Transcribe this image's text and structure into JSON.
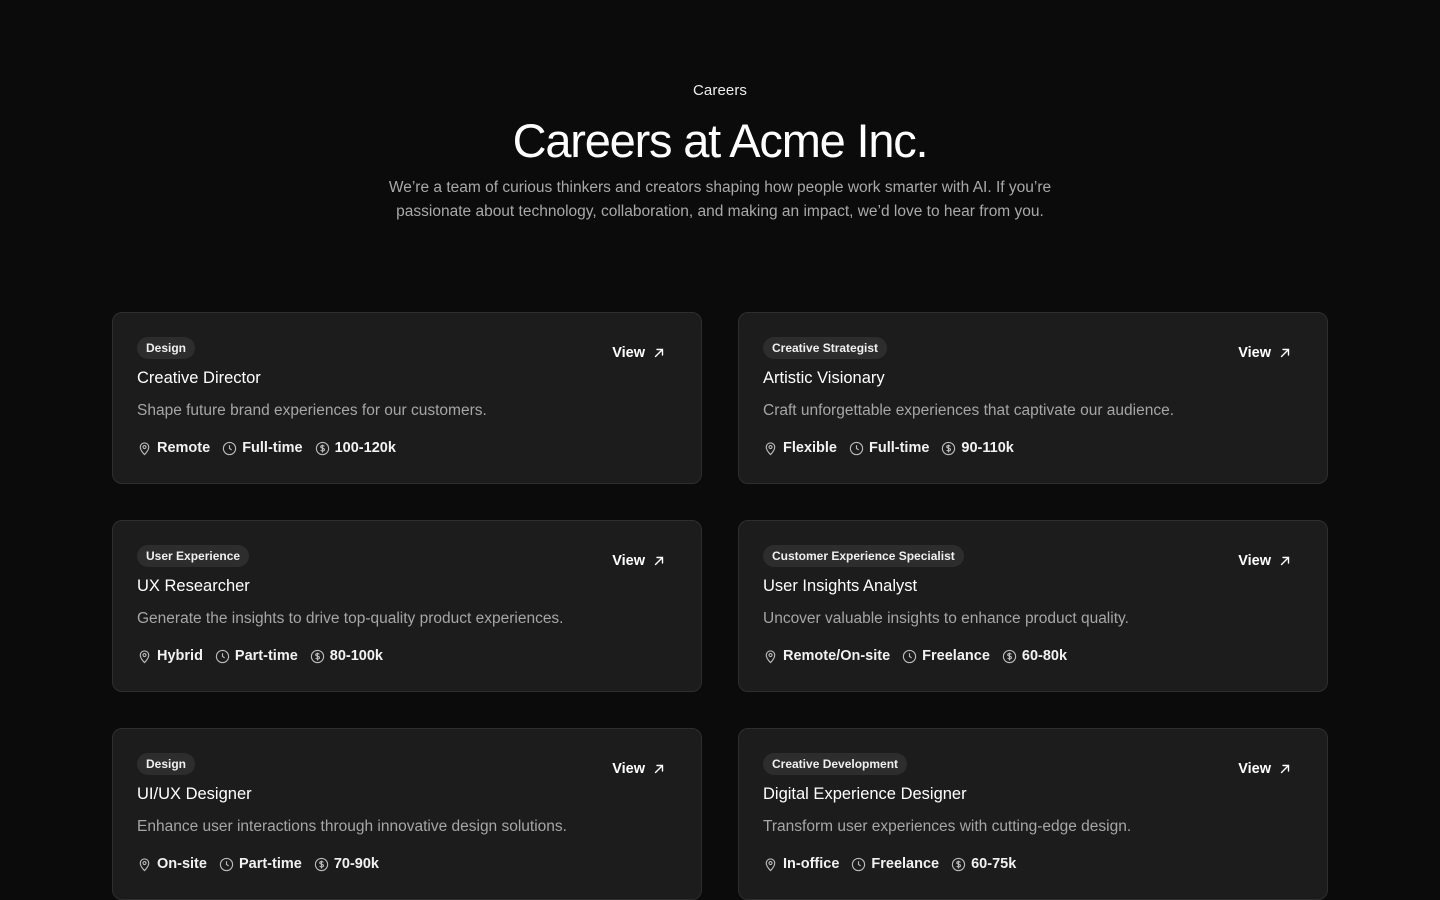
{
  "header": {
    "eyebrow": "Careers",
    "title": "Careers at Acme Inc.",
    "subtitle": "We’re a team of curious thinkers and creators shaping how people work smarter with AI. If you’re passionate about technology, collaboration, and making an impact, we’d love to hear from you."
  },
  "jobs": [
    {
      "category": "Design",
      "title": "Creative Director",
      "description": "Shape future brand experiences for our customers.",
      "location": "Remote",
      "type": "Full-time",
      "salary": "100-120k",
      "view_label": "View"
    },
    {
      "category": "Creative Strategist",
      "title": "Artistic Visionary",
      "description": "Craft unforgettable experiences that captivate our audience.",
      "location": "Flexible",
      "type": "Full-time",
      "salary": "90-110k",
      "view_label": "View"
    },
    {
      "category": "User Experience",
      "title": "UX Researcher",
      "description": "Generate the insights to drive top-quality product experiences.",
      "location": "Hybrid",
      "type": "Part-time",
      "salary": "80-100k",
      "view_label": "View"
    },
    {
      "category": "Customer Experience Specialist",
      "title": "User Insights Analyst",
      "description": "Uncover valuable insights to enhance product quality.",
      "location": "Remote/On-site",
      "type": "Freelance",
      "salary": "60-80k",
      "view_label": "View"
    },
    {
      "category": "Design",
      "title": "UI/UX Designer",
      "description": "Enhance user interactions through innovative design solutions.",
      "location": "On-site",
      "type": "Part-time",
      "salary": "70-90k",
      "view_label": "View"
    },
    {
      "category": "Creative Development",
      "title": "Digital Experience Designer",
      "description": "Transform user experiences with cutting-edge design.",
      "location": "In-office",
      "type": "Freelance",
      "salary": "60-75k",
      "view_label": "View"
    }
  ],
  "icons": {
    "view": "arrow-up-right-icon",
    "location": "map-pin-icon",
    "type": "clock-icon",
    "salary": "dollar-circle-icon"
  },
  "colors": {
    "background": "#0b0b0b",
    "card": "#1c1c1c",
    "card_border": "#2e2e2e",
    "badge": "#2d2d2d",
    "muted_text": "#a6a6a6"
  }
}
